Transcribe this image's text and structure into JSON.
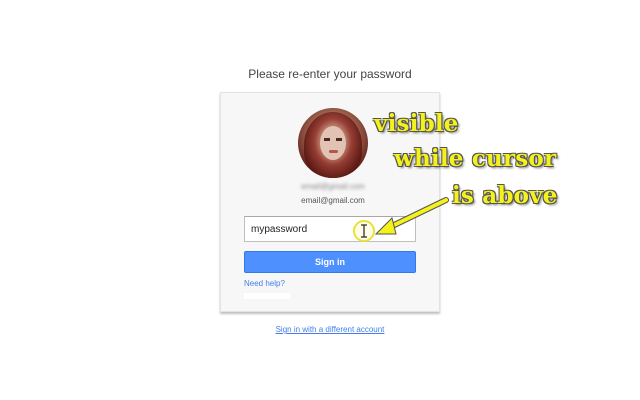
{
  "page": {
    "heading": "Please re-enter your password"
  },
  "card": {
    "name_blurred": "email@gmail.com",
    "email": "email@gmail.com",
    "password_value": "mypassword",
    "signin_label": "Sign in",
    "need_help_label": "Need help?"
  },
  "footer": {
    "different_account_label": "Sign in with a different account"
  },
  "annotation": {
    "line1": "visible",
    "line2": "while cursor",
    "line3": "is above",
    "color": "#f4f21a"
  },
  "colors": {
    "button_blue": "#4d90fe",
    "link_blue": "#427fed",
    "card_bg": "#f7f7f7"
  }
}
